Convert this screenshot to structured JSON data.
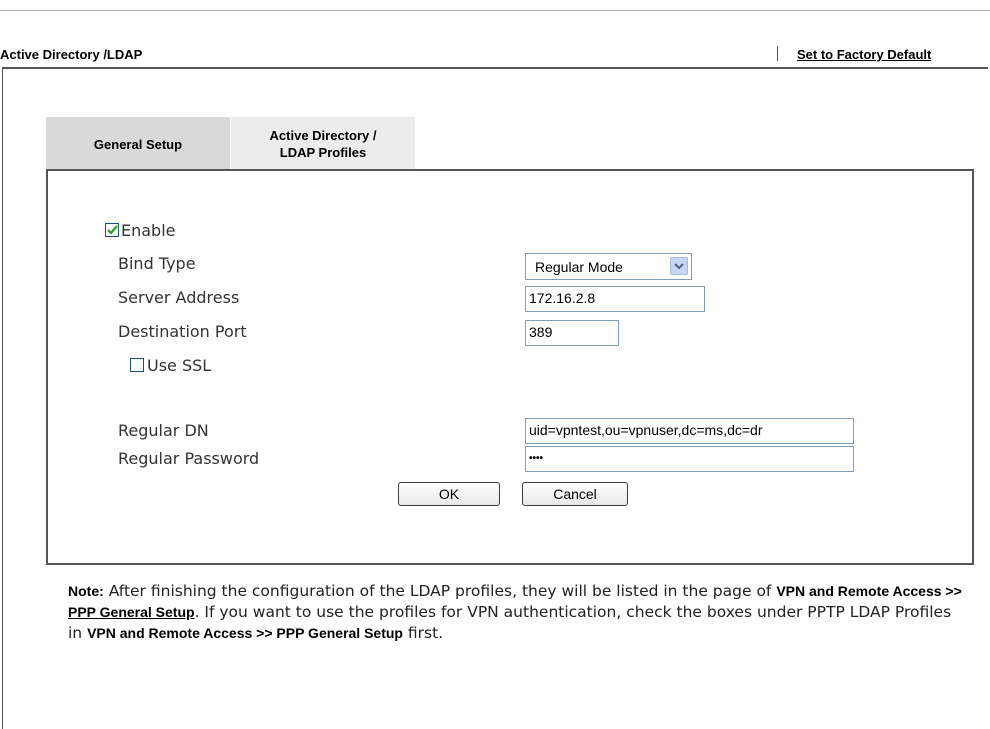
{
  "header": {
    "title": "Active Directory /LDAP",
    "factory_default": "Set to Factory Default"
  },
  "tabs": [
    {
      "label": "General Setup"
    },
    {
      "label_line1": "Active Directory /",
      "label_line2": "LDAP Profiles"
    }
  ],
  "form": {
    "enable": {
      "label": "Enable",
      "checked": true
    },
    "bind_type": {
      "label": "Bind Type",
      "value": "Regular Mode"
    },
    "server_address": {
      "label": "Server Address",
      "value": "172.16.2.8"
    },
    "destination_port": {
      "label": "Destination Port",
      "value": "389"
    },
    "use_ssl": {
      "label": "Use SSL",
      "checked": false
    },
    "regular_dn": {
      "label": "Regular DN",
      "value": "uid=vpntest,ou=vpnuser,dc=ms,dc=dr"
    },
    "regular_password": {
      "label": "Regular Password",
      "value": "••••"
    }
  },
  "buttons": {
    "ok": "OK",
    "cancel": "Cancel"
  },
  "note": {
    "prefix": "Note:",
    "text1": " After finishing the configuration of the LDAP profiles, they will be listed in the page of ",
    "link_part1": "VPN and Remote Access >> ",
    "link_part2": "PPP General Setup",
    "text2": ". If you want to use the profiles for VPN authentication, check the boxes under PPTP LDAP Profiles in ",
    "bold2": "VPN and Remote Access >> PPP General Setup",
    "text3": " first."
  },
  "colors": {
    "checkmark": "#21a121",
    "separator": "#e01818"
  }
}
